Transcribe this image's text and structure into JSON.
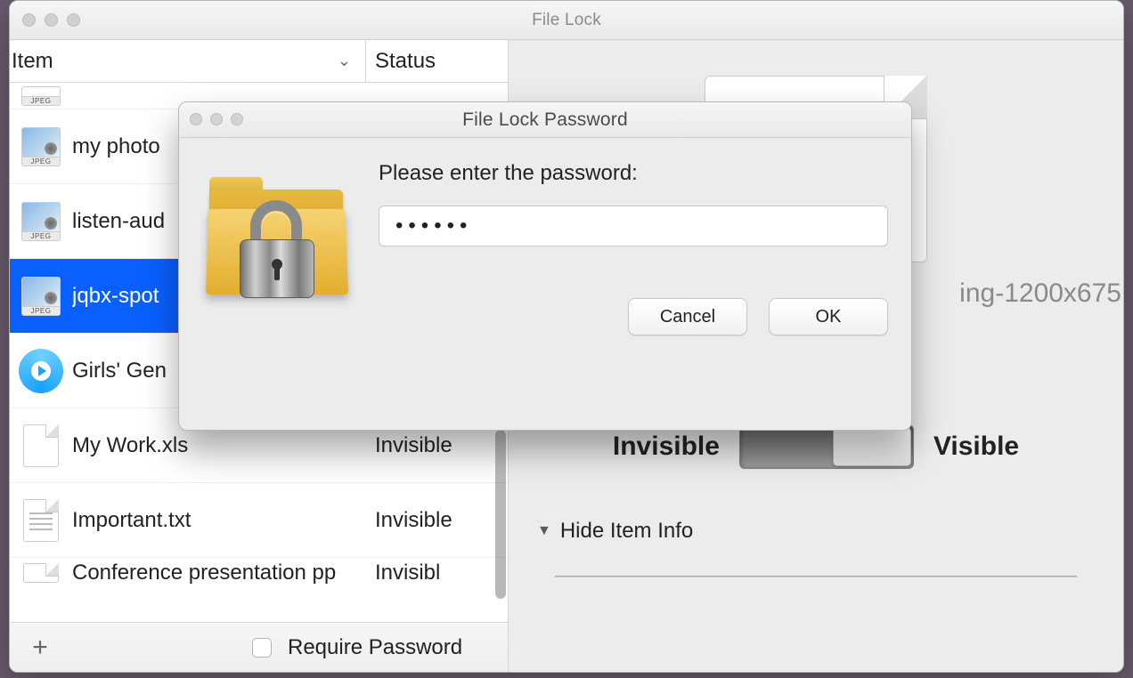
{
  "window": {
    "title": "File Lock"
  },
  "columns": {
    "item_label": "Item",
    "status_label": "Status"
  },
  "rows": [
    {
      "name": "my photo",
      "status": "",
      "type": "jpeg"
    },
    {
      "name": "listen-aud",
      "status": "",
      "type": "jpeg"
    },
    {
      "name": "jqbx-spot",
      "status": "",
      "type": "jpeg",
      "selected": true
    },
    {
      "name": "Girls' Gen",
      "status": "",
      "type": "audio"
    },
    {
      "name": "My Work.xls",
      "status": "Invisible",
      "type": "doc"
    },
    {
      "name": "Important.txt",
      "status": "Invisible",
      "type": "txt"
    },
    {
      "name": "Conference presentation pp",
      "status": "Invisibl",
      "type": "doc"
    }
  ],
  "thumb_tag": "JPEG",
  "bottom": {
    "require_password_label": "Require Password"
  },
  "preview": {
    "filename_fragment": "ing-1200x675",
    "invisible_label": "Invisible",
    "visible_label": "Visible",
    "disclosure_label": "Hide Item Info"
  },
  "modal": {
    "title": "File Lock Password",
    "prompt": "Please enter the password:",
    "password_value": "••••••",
    "cancel_label": "Cancel",
    "ok_label": "OK"
  }
}
